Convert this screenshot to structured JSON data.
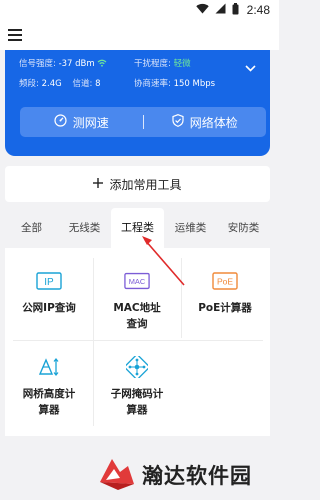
{
  "status_bar": {
    "time": "2:48",
    "icons": [
      "wifi-icon",
      "signal-icon",
      "battery-icon"
    ]
  },
  "app_bar": {
    "menu_icon": "hamburger-menu-icon"
  },
  "wifi_info": {
    "signal_label": "信号强度:",
    "signal_value": "-37 dBm",
    "interference_label": "干扰程度:",
    "interference_value": "轻微",
    "band_label": "频段:",
    "band_value": "2.4G",
    "channel_label": "信道:",
    "channel_value": "8",
    "rate_label": "协商速率:",
    "rate_value": "150 Mbps",
    "accent_color": "#1767e6",
    "good_color": "#6ee89a"
  },
  "actions": {
    "speed_test": "测网速",
    "network_check": "网络体检"
  },
  "add_tools": {
    "label": "添加常用工具"
  },
  "tabs": [
    {
      "label": "全部",
      "active": false
    },
    {
      "label": "无线类",
      "active": false
    },
    {
      "label": "工程类",
      "active": true
    },
    {
      "label": "运维类",
      "active": false
    },
    {
      "label": "安防类",
      "active": false
    }
  ],
  "tools": [
    {
      "label_line1": "公网IP查询",
      "label_line2": "",
      "icon_text": "IP",
      "icon_color": "#1aa3d6"
    },
    {
      "label_line1": "MAC地址",
      "label_line2": "查询",
      "icon_text": "MAC",
      "icon_color": "#7b5cd6"
    },
    {
      "label_line1": "PoE计算器",
      "label_line2": "",
      "icon_text": "PoE",
      "icon_color": "#f08a3a"
    },
    {
      "label_line1": "网桥高度计",
      "label_line2": "算器",
      "icon_text": "",
      "icon_color": "#1aa3d6"
    },
    {
      "label_line1": "子网掩码计",
      "label_line2": "算器",
      "icon_text": "",
      "icon_color": "#1aa3d6"
    }
  ],
  "watermark": {
    "text": "瀚达软件园"
  }
}
